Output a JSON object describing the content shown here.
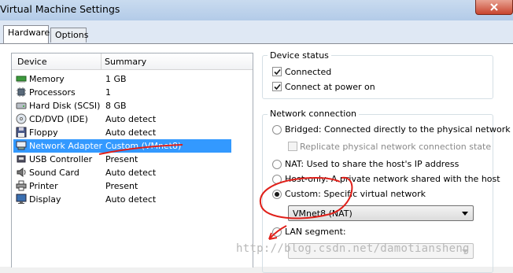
{
  "window": {
    "title": "Virtual Machine Settings"
  },
  "tabs": [
    {
      "label": "Hardware",
      "active": true
    },
    {
      "label": "Options",
      "active": false
    }
  ],
  "device_list": {
    "headers": {
      "device": "Device",
      "summary": "Summary"
    },
    "rows": [
      {
        "device": "Memory",
        "summary": "1 GB",
        "icon": "memory-icon",
        "selected": false
      },
      {
        "device": "Processors",
        "summary": "1",
        "icon": "processor-icon",
        "selected": false
      },
      {
        "device": "Hard Disk (SCSI)",
        "summary": "8 GB",
        "icon": "hard-disk-icon",
        "selected": false
      },
      {
        "device": "CD/DVD (IDE)",
        "summary": "Auto detect",
        "icon": "cd-dvd-icon",
        "selected": false
      },
      {
        "device": "Floppy",
        "summary": "Auto detect",
        "icon": "floppy-icon",
        "selected": false
      },
      {
        "device": "Network Adapter",
        "summary": "Custom (VMnet8)",
        "icon": "network-adapter-icon",
        "selected": true
      },
      {
        "device": "USB Controller",
        "summary": "Present",
        "icon": "usb-icon",
        "selected": false
      },
      {
        "device": "Sound Card",
        "summary": "Auto detect",
        "icon": "sound-card-icon",
        "selected": false
      },
      {
        "device": "Printer",
        "summary": "Present",
        "icon": "printer-icon",
        "selected": false
      },
      {
        "device": "Display",
        "summary": "Auto detect",
        "icon": "display-icon",
        "selected": false
      }
    ]
  },
  "device_status": {
    "title": "Device status",
    "connected": {
      "label": "Connected",
      "checked": true
    },
    "connect_at_power_on": {
      "label": "Connect at power on",
      "checked": true
    }
  },
  "network_connection": {
    "title": "Network connection",
    "bridged": {
      "label": "Bridged: Connected directly to the physical network",
      "selected": false
    },
    "replicate": {
      "label": "Replicate physical network connection state",
      "checked": false,
      "enabled": false
    },
    "nat": {
      "label": "NAT: Used to share the host's IP address",
      "selected": false
    },
    "host_only": {
      "label": "Host-only: A private network shared with the host",
      "selected": false
    },
    "custom": {
      "label": "Custom: Specific virtual network",
      "selected": true
    },
    "custom_network_value": "VMnet8 (NAT)",
    "lan_segment": {
      "label": "LAN segment:",
      "selected": false
    },
    "lan_segment_value": ""
  },
  "watermark": "http://blog.csdn.net/damotiansheng",
  "colors": {
    "selection": "#3399ff",
    "annotation": "#e0201a"
  }
}
